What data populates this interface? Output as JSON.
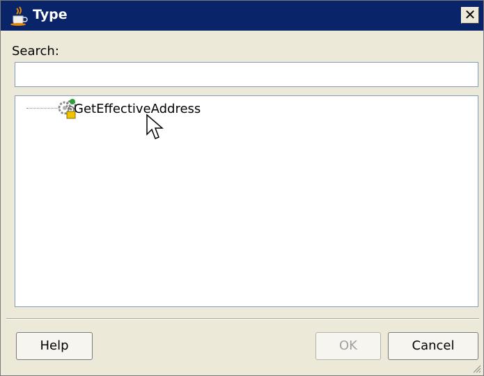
{
  "window": {
    "title": "Type",
    "title_icon": "java-cup-icon",
    "close_icon": "close-icon",
    "close_glyph": "✕"
  },
  "search": {
    "label": "Search:",
    "value": "",
    "placeholder": ""
  },
  "tree": {
    "items": [
      {
        "label": "GetEffectiveAddress",
        "icon": "service-gear-lock-icon"
      }
    ]
  },
  "buttons": {
    "help": "Help",
    "ok": "OK",
    "cancel": "Cancel"
  },
  "colors": {
    "titlebar": "#0a246a",
    "dialog_bg": "#ece9d8",
    "panel_border": "#7f9db9"
  }
}
